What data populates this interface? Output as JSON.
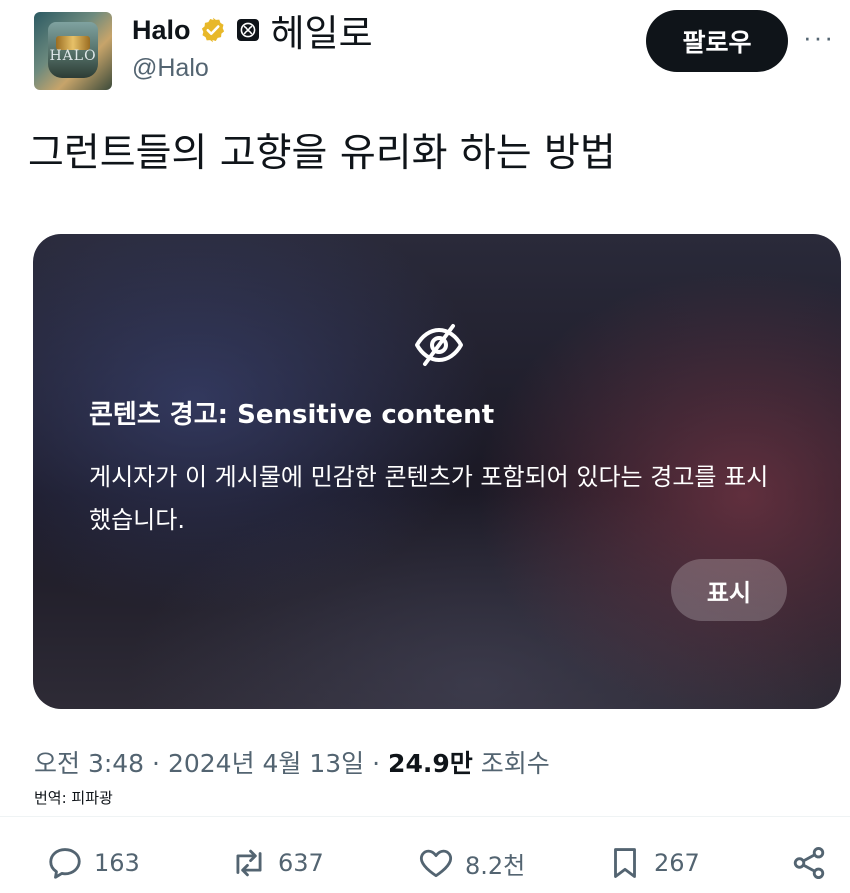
{
  "header": {
    "display_name": "Halo",
    "affiliate_name": "헤일로",
    "handle": "@Halo",
    "avatar_logo": "HALO",
    "follow_label": "팔로우",
    "more_label": "···",
    "verified_color": "#E8B829"
  },
  "tweet": {
    "text": "그런트들의 고향을 유리화 하는 방법"
  },
  "media": {
    "icon": "eye-slash-icon",
    "warning_title": "콘텐츠 경고: Sensitive content",
    "warning_body": "게시자가 이 게시물에 민감한 콘텐츠가 포함되어 있다는 경고를 표시했습니다.",
    "show_label": "표시"
  },
  "meta": {
    "time": "오전 3:48",
    "date": "2024년 4월 13일",
    "views_count": "24.9만",
    "views_label": "조회수",
    "translation": "번역: 피파광"
  },
  "actions": {
    "replies": "163",
    "reposts": "637",
    "likes": "8.2천",
    "bookmarks": "267"
  }
}
